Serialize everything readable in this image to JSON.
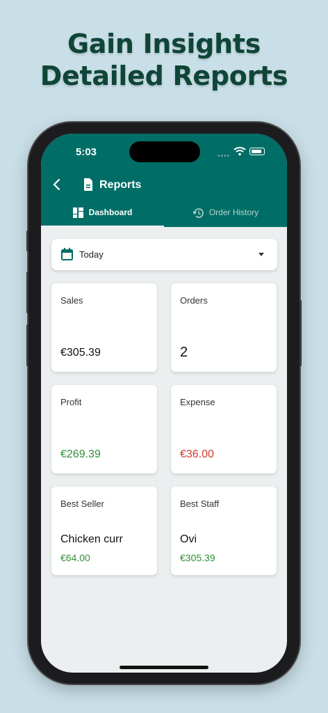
{
  "headline": {
    "line1": "Gain Insights",
    "line2": "Detailed Reports"
  },
  "status_bar": {
    "time": "5:03",
    "signal": "••••"
  },
  "app_bar": {
    "title": "Reports"
  },
  "tabs": [
    {
      "label": "Dashboard",
      "icon": "dashboard-icon",
      "selected": true
    },
    {
      "label": "Order History",
      "icon": "history-icon",
      "selected": false
    }
  ],
  "period_dropdown": {
    "value": "Today",
    "icon": "calendar-icon"
  },
  "cards": {
    "sales": {
      "label": "Sales",
      "value": "€305.39"
    },
    "orders": {
      "label": "Orders",
      "value": "2"
    },
    "profit": {
      "label": "Profit",
      "value": "€269.39",
      "color": "#2f8f38"
    },
    "expense": {
      "label": "Expense",
      "value": "€36.00",
      "color": "#d23a32"
    },
    "best_seller": {
      "label": "Best Seller",
      "name": "Chicken curr",
      "amount": "€64.00"
    },
    "best_staff": {
      "label": "Best Staff",
      "name": "Ovi",
      "amount": "€305.39"
    }
  },
  "colors": {
    "app_bar": "#006e66",
    "background": "#c9dfe8",
    "headline": "#0f4536"
  }
}
